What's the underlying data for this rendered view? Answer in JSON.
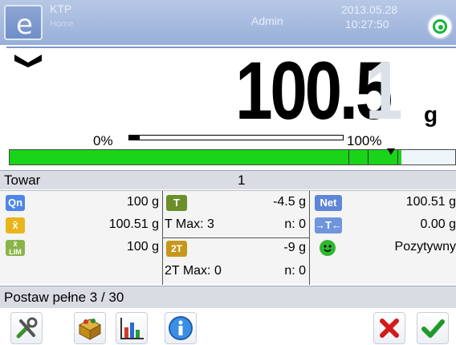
{
  "header": {
    "user": "KTP",
    "subtitle": "Home",
    "role": "Admin",
    "date": "2013.05.28",
    "time": "10:27:50",
    "status_color": "#17b33c"
  },
  "display": {
    "weight_value": "100.5",
    "ghost_digit": "1",
    "unit": "g",
    "range_min_label": "0%",
    "range_max_label": "100%",
    "load_fraction": 0.05
  },
  "bargraph": {
    "fill_fraction": 0.88,
    "color": "#19d419"
  },
  "product": {
    "label": "Towar",
    "value": "1"
  },
  "info": {
    "col1": [
      {
        "icon": "qn-icon",
        "value": "100 g"
      },
      {
        "icon": "x-mean-icon",
        "value": "100.51 g"
      },
      {
        "icon": "x-lim-icon",
        "value": "100 g"
      }
    ],
    "col2": {
      "tare": "-4.5 g",
      "t_max": "T Max: 3",
      "n1": "n: 0",
      "tare2": "-9 g",
      "t2_max": "2T Max: 0",
      "n2": "n: 0"
    },
    "col3": [
      {
        "icon": "net-icon",
        "label": "Net",
        "value": "100.51 g"
      },
      {
        "icon": "tare-icon",
        "label": "T",
        "value": "0.00 g"
      },
      {
        "icon": "smiley-icon",
        "value": "Pozytywny"
      }
    ]
  },
  "message": {
    "text": "Postaw pełne 3 / 30"
  },
  "toolbar": {
    "buttons": [
      "settings-icon",
      "product-box-icon",
      "statistics-icon",
      "info-icon",
      "cancel-icon",
      "accept-icon"
    ]
  }
}
